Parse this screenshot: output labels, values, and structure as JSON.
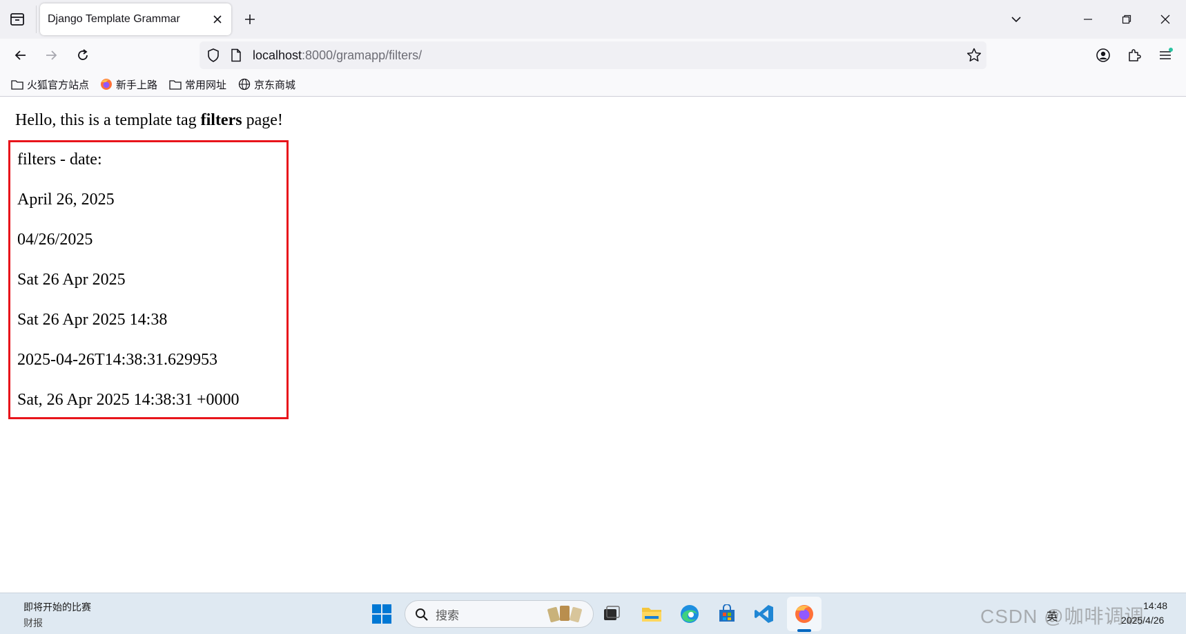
{
  "browser": {
    "tab": {
      "title": "Django Template Grammar"
    },
    "url": {
      "host": "localhost",
      "rest": ":8000/gramapp/filters/"
    },
    "bookmarks": [
      {
        "label": "火狐官方站点"
      },
      {
        "label": "新手上路"
      },
      {
        "label": "常用网址"
      },
      {
        "label": "京东商城"
      }
    ]
  },
  "page": {
    "intro_before": "Hello, this is a template tag ",
    "intro_bold": "filters",
    "intro_after": " page!",
    "filter_lines": [
      "filters - date:",
      "April 26, 2025",
      "04/26/2025",
      "Sat 26 Apr 2025",
      "Sat 26 Apr 2025 14:38",
      "2025-04-26T14:38:31.629953",
      "Sat, 26 Apr 2025 14:38:31 +0000"
    ],
    "highlight_color": "#e8141b"
  },
  "taskbar": {
    "news_title": "即将开始的比赛",
    "news_sub": "财报",
    "search_placeholder": "搜索",
    "ime": "英",
    "time": "14:48",
    "date": "2025/4/26",
    "watermark": "CSDN @咖啡调调"
  }
}
